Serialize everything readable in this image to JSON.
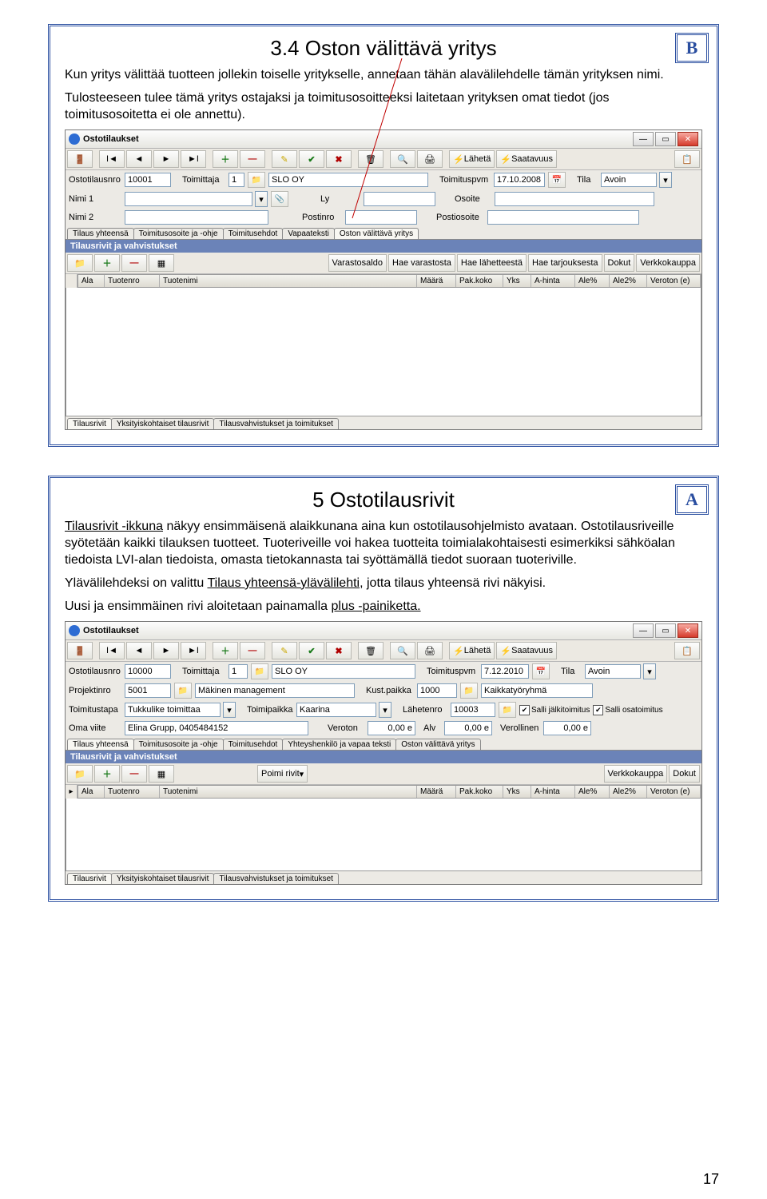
{
  "page_number": "17",
  "slide1": {
    "badge": "B",
    "title": "3.4 Oston välittävä yritys",
    "para1": "Kun yritys välittää tuotteen jollekin toiselle yritykselle, annetaan tähän alavälilehdelle tämän yrityksen nimi.",
    "para2": "Tulosteeseen tulee tämä yritys ostajaksi ja toimitusosoitteeksi laitetaan yrityksen omat tiedot (jos toimitusosoitetta ei ole annettu).",
    "window": {
      "title": "Ostotilaukset",
      "toolbar": {
        "laheta": "Lähetä",
        "saatavuus": "Saatavuus"
      },
      "labels": {
        "ostotilausnro": "Ostotilausnro",
        "toimittaja": "Toimittaja",
        "toimituspvm": "Toimituspvm",
        "tila": "Tila",
        "nimi1": "Nimi 1",
        "ly": "Ly",
        "osoite": "Osoite",
        "nimi2": "Nimi 2",
        "postinro": "Postinro",
        "postiosoite": "Postiosoite"
      },
      "values": {
        "ostotilausnro": "10001",
        "toimittaja_id": "1",
        "toimittaja_name": "SLO OY",
        "toimituspvm": "17.10.2008",
        "tila": "Avoin"
      },
      "tabs_top": [
        "Tilaus yhteensä",
        "Toimitusosoite ja -ohje",
        "Toimitusehdot",
        "Vapaateksti",
        "Oston välittävä yritys"
      ],
      "section": "Tilausrivit ja vahvistukset",
      "sub_buttons": [
        "Varastosaldo",
        "Hae varastosta",
        "Hae lähetteestä",
        "Hae tarjouksesta",
        "Dokut",
        "Verkkokauppa"
      ],
      "grid_cols": [
        "Ala",
        "Tuotenro",
        "Tuotenimi",
        "Määrä",
        "Pak.koko",
        "Yks",
        "A-hinta",
        "Ale%",
        "Ale2%",
        "Veroton (e)"
      ],
      "tabs_bottom": [
        "Tilausrivit",
        "Yksityiskohtaiset tilausrivit",
        "Tilausvahvistukset ja toimitukset"
      ]
    }
  },
  "slide2": {
    "badge": "A",
    "title": "5 Ostotilausrivit",
    "para1a": "Tilausrivit -ikkuna",
    "para1b": " näkyy ensimmäisenä alaikkunana aina kun ostotilausohjelmisto avataan. Ostotilausriveille syötetään kaikki tilauksen tuotteet. Tuoteriveille voi hakea tuotteita toimialakohtaisesti esimerkiksi sähköalan tiedoista LVI-alan tiedoista, omasta tietokannasta tai syöttämällä tiedot suoraan tuoteriville.",
    "para2a": "Ylävälilehdeksi on valittu ",
    "para2b": "Tilaus yhteensä-ylävälilehti",
    "para2c": ", jotta tilaus yhteensä rivi näkyisi.",
    "para3a": "Uusi ja ensimmäinen rivi aloitetaan painamalla ",
    "para3b": "plus -painiketta.",
    "window": {
      "title": "Ostotilaukset",
      "toolbar": {
        "laheta": "Lähetä",
        "saatavuus": "Saatavuus"
      },
      "labels": {
        "ostotilausnro": "Ostotilausnro",
        "toimittaja": "Toimittaja",
        "toimituspvm": "Toimituspvm",
        "tila": "Tila",
        "projektinro": "Projektinro",
        "kustpaikka": "Kust.paikka",
        "toimitustapa": "Toimitustapa",
        "toimipaikka": "Toimipaikka",
        "lahetenro": "Lähetenro",
        "salli_jalki": "Salli jälkitoimitus",
        "salli_osa": "Salli osatoimitus",
        "omaviite": "Oma viite",
        "veroton": "Veroton",
        "alv": "Alv",
        "verollinen": "Verollinen"
      },
      "values": {
        "ostotilausnro": "10000",
        "toimittaja_id": "1",
        "toimittaja_name": "SLO OY",
        "toimituspvm": "7.12.2010",
        "tila": "Avoin",
        "projektinro": "5001",
        "projekti_name": "Mäkinen management",
        "kustpaikka": "1000",
        "kustpaikka_name": "Kaikkatyöryhmä",
        "toimitustapa": "Tukkulike toimittaa",
        "toimipaikka": "Kaarina",
        "lahetenro": "10003",
        "omaviite": "Elina Grupp, 0405484152",
        "veroton": "0,00 e",
        "alv": "0,00 e",
        "verollinen": "0,00 e"
      },
      "tabs_top": [
        "Tilaus yhteensä",
        "Toimitusosoite ja -ohje",
        "Toimitusehdot",
        "Yhteyshenkilö ja vapaa teksti",
        "Oston välittävä yritys"
      ],
      "section": "Tilausrivit ja vahvistukset",
      "sub_buttons_left": [
        "Poimi rivit"
      ],
      "sub_buttons_right": [
        "Verkkokauppa",
        "Dokut"
      ],
      "grid_cols": [
        "Ala",
        "Tuotenro",
        "Tuotenimi",
        "Määrä",
        "Pak.koko",
        "Yks",
        "A-hinta",
        "Ale%",
        "Ale2%",
        "Veroton (e)"
      ],
      "tabs_bottom": [
        "Tilausrivit",
        "Yksityiskohtaiset tilausrivit",
        "Tilausvahvistukset ja toimitukset"
      ]
    }
  }
}
